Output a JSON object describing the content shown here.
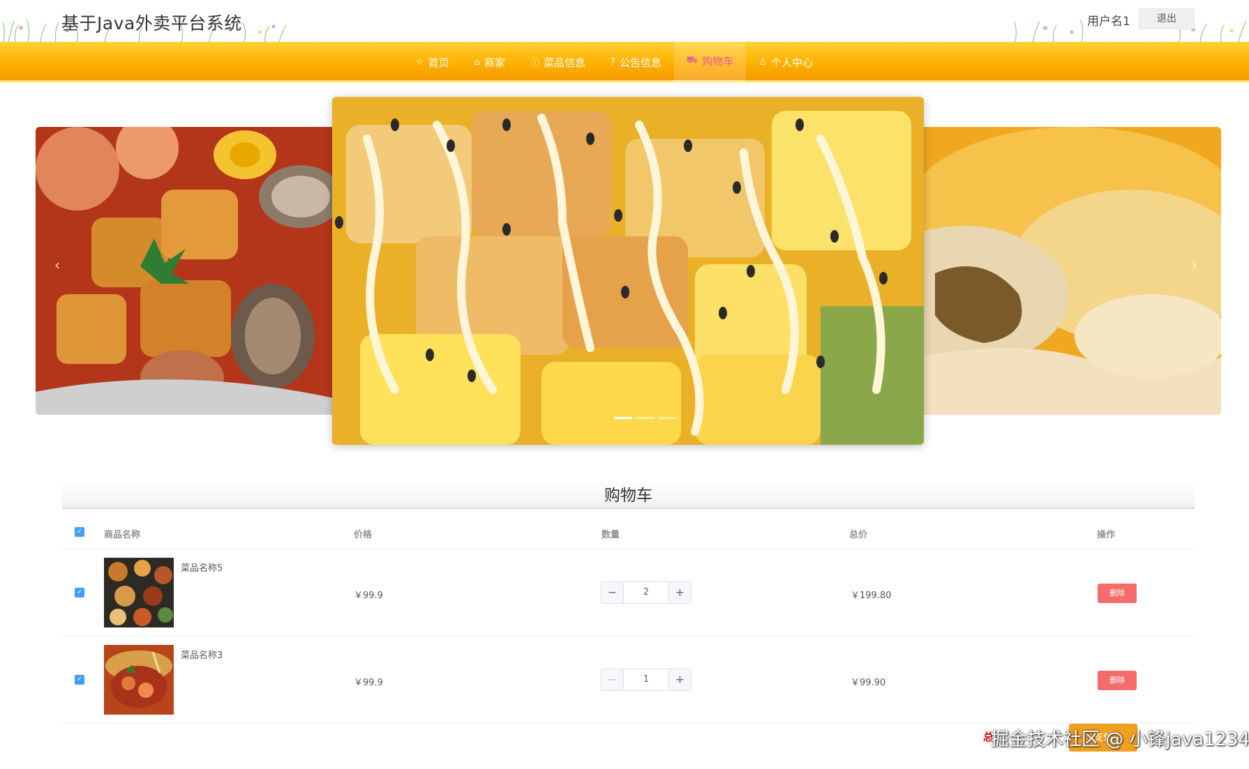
{
  "header": {
    "site_title": "基于Java外卖平台系统",
    "username": "用户名1",
    "logout_label": "退出"
  },
  "nav": {
    "items": [
      {
        "icon": "star-icon",
        "glyph": "☆",
        "label": "首页"
      },
      {
        "icon": "shop-icon",
        "glyph": "⌂",
        "label": "商家"
      },
      {
        "icon": "info-icon",
        "glyph": "ⓘ",
        "label": "菜品信息"
      },
      {
        "icon": "question-icon",
        "glyph": "?",
        "label": "公告信息"
      },
      {
        "icon": "cart-icon",
        "glyph": "⛟",
        "label": "购物车"
      },
      {
        "icon": "user-icon",
        "glyph": "♙",
        "label": "个人中心"
      }
    ],
    "active_index": 4
  },
  "carousel": {
    "prev_glyph": "‹",
    "next_glyph": "›"
  },
  "cart": {
    "title": "购物车",
    "columns": {
      "name": "商品名称",
      "price": "价格",
      "quantity": "数量",
      "total": "总价",
      "action": "操作"
    },
    "rows": [
      {
        "name": "菜品名称5",
        "price": "￥99.9",
        "quantity": "2",
        "total": "￥199.80",
        "delete_label": "删除",
        "checked": true
      },
      {
        "name": "菜品名称3",
        "price": "￥99.9",
        "quantity": "1",
        "total": "￥99.90",
        "delete_label": "删除",
        "checked": true
      }
    ],
    "footer_total_label": "总",
    "checkout_label": "支付"
  },
  "watermark": "掘金技术社区 @ 小锋java1234",
  "colors": {
    "nav_gradient_top": "#ffd23a",
    "nav_gradient_bottom": "#f59a00",
    "active_nav_text": "#e65aa0",
    "delete_button": "#f56c6c",
    "checkbox": "#409eff",
    "checkout_button": "#f0a020"
  }
}
